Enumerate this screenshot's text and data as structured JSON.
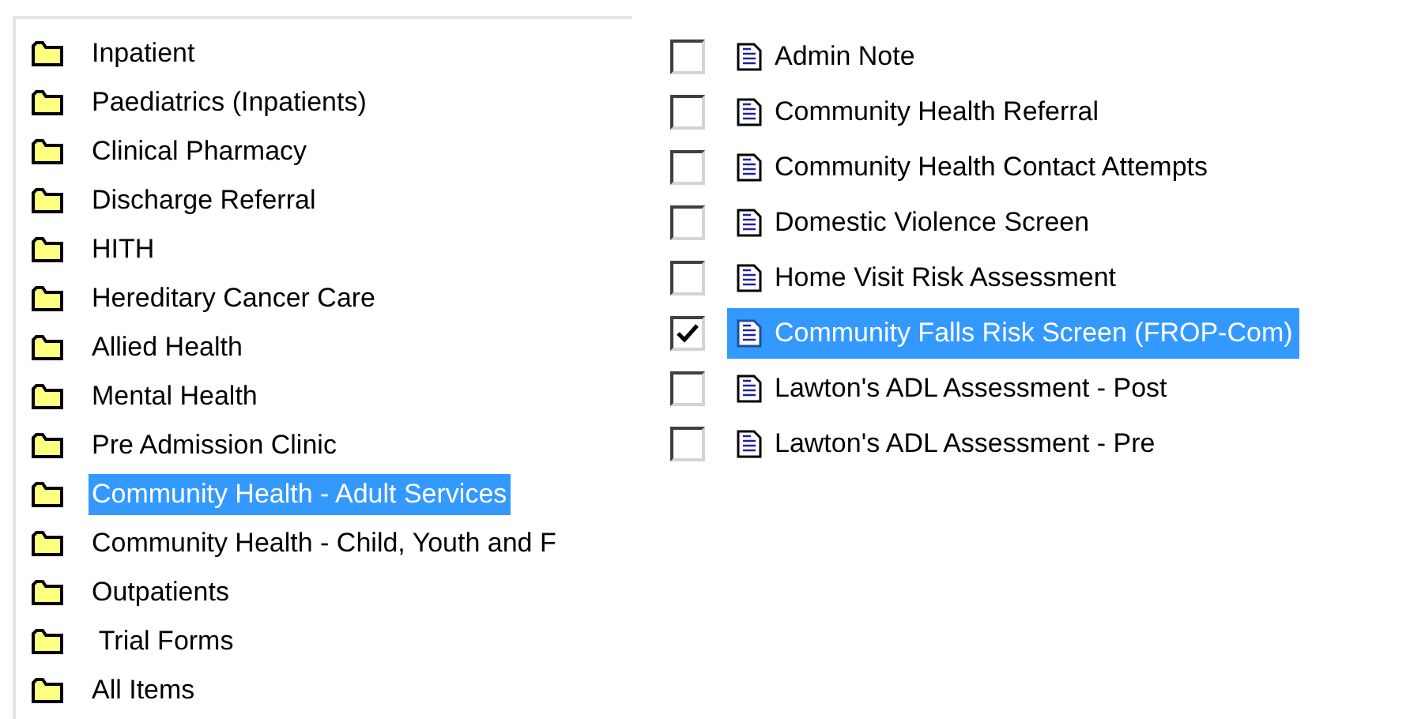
{
  "folders": [
    {
      "label": "Inpatient",
      "selected": false
    },
    {
      "label": "Paediatrics (Inpatients)",
      "selected": false
    },
    {
      "label": "Clinical Pharmacy",
      "selected": false
    },
    {
      "label": "Discharge Referral",
      "selected": false
    },
    {
      "label": "HITH",
      "selected": false
    },
    {
      "label": "Hereditary Cancer Care",
      "selected": false
    },
    {
      "label": "Allied Health",
      "selected": false
    },
    {
      "label": "Mental Health",
      "selected": false
    },
    {
      "label": "Pre Admission Clinic",
      "selected": false
    },
    {
      "label": "Community Health - Adult Services",
      "selected": true
    },
    {
      "label": "Community Health - Child, Youth and F",
      "selected": false
    },
    {
      "label": "Outpatients",
      "selected": false
    },
    {
      "label": " Trial Forms",
      "selected": false
    },
    {
      "label": "All Items",
      "selected": false
    }
  ],
  "forms": [
    {
      "label": "Admin Note",
      "checked": false,
      "selected": false
    },
    {
      "label": "Community Health Referral",
      "checked": false,
      "selected": false
    },
    {
      "label": "Community Health Contact Attempts",
      "checked": false,
      "selected": false
    },
    {
      "label": "Domestic Violence Screen",
      "checked": false,
      "selected": false
    },
    {
      "label": "Home Visit Risk Assessment",
      "checked": false,
      "selected": false
    },
    {
      "label": "Community Falls Risk Screen (FROP-Com)",
      "checked": true,
      "selected": true
    },
    {
      "label": "Lawton's ADL Assessment - Post",
      "checked": false,
      "selected": false
    },
    {
      "label": "Lawton's ADL Assessment - Pre",
      "checked": false,
      "selected": false
    }
  ]
}
